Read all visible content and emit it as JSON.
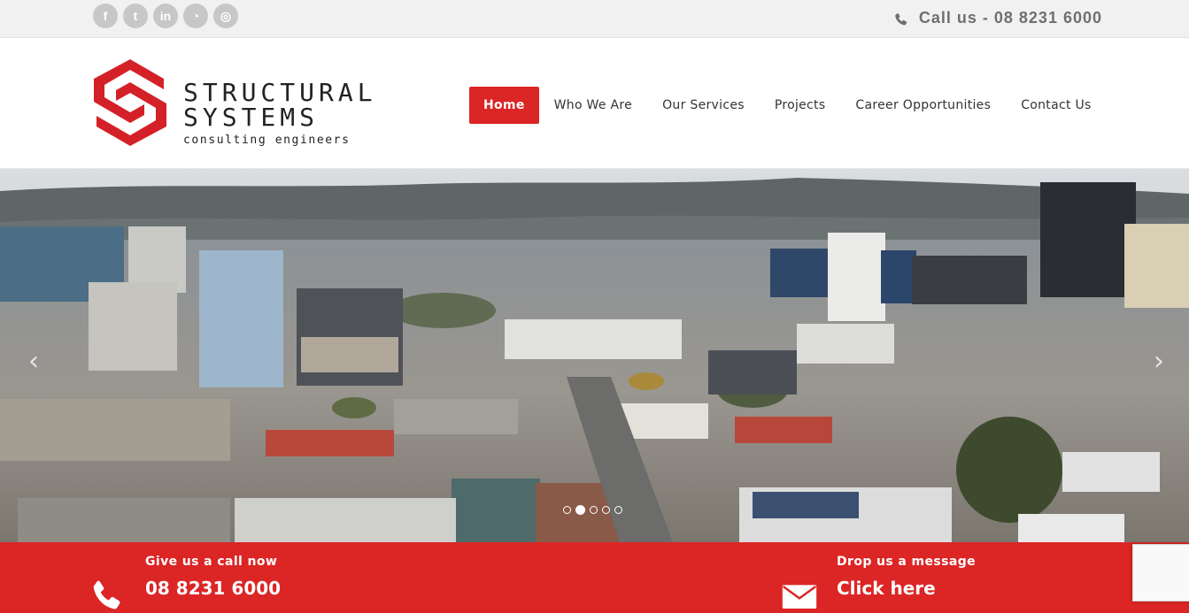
{
  "topbar": {
    "social": [
      {
        "icon": "facebook-icon",
        "glyph": "f"
      },
      {
        "icon": "twitter-icon",
        "glyph": "t"
      },
      {
        "icon": "linkedin-icon",
        "glyph": "in"
      },
      {
        "icon": "wechat-icon",
        "glyph": "◔"
      },
      {
        "icon": "instagram-icon",
        "glyph": "◎"
      }
    ],
    "call_text": "Call us - 08 8231 6000"
  },
  "logo": {
    "line1": "STRUCTURAL",
    "line2": "SYSTEMS",
    "line3": "consulting engineers",
    "brand_color": "#d42127"
  },
  "nav": {
    "items": [
      {
        "label": "Home",
        "active": true
      },
      {
        "label": "Who We Are",
        "active": false
      },
      {
        "label": "Our Services",
        "active": false
      },
      {
        "label": "Projects",
        "active": false
      },
      {
        "label": "Career Opportunities",
        "active": false
      },
      {
        "label": "Contact Us",
        "active": false
      }
    ]
  },
  "hero": {
    "prev_glyph": "‹",
    "next_glyph": "›",
    "slide_count": 5,
    "active_slide": 1
  },
  "footer": {
    "call": {
      "title": "Give us a call now",
      "sub": "08 8231 6000"
    },
    "message": {
      "title": "Drop us a message",
      "sub": "Click here"
    },
    "accent": "#dc2525"
  }
}
